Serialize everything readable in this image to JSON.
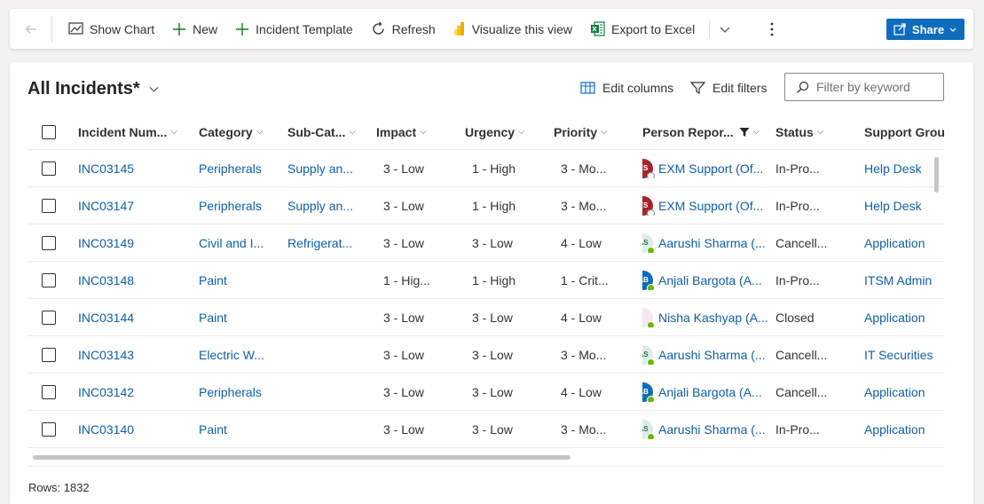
{
  "toolbar": {
    "show_chart": "Show Chart",
    "new": "New",
    "incident_template": "Incident Template",
    "refresh": "Refresh",
    "visualize": "Visualize this view",
    "export": "Export to Excel",
    "share": "Share"
  },
  "view": {
    "title": "All Incidents*",
    "edit_columns": "Edit columns",
    "edit_filters": "Edit filters",
    "filter_placeholder": "Filter by keyword"
  },
  "columns": {
    "incident_number": "Incident Num...",
    "category": "Category",
    "sub_category": "Sub-Cat...",
    "impact": "Impact",
    "urgency": "Urgency",
    "priority": "Priority",
    "person_reported": "Person Repor...",
    "status": "Status",
    "support_group": "Support Group"
  },
  "rows": [
    {
      "num": "INC03145",
      "category": "Peripherals",
      "sub": "Supply an...",
      "impact": "3 - Low",
      "urgency": "1 - High",
      "priority": "3 - Mo...",
      "initials": "ES",
      "person": "EXM Support (Of...",
      "status": "In-Pro...",
      "group": "Help Desk"
    },
    {
      "num": "INC03147",
      "category": "Peripherals",
      "sub": "Supply an...",
      "impact": "3 - Low",
      "urgency": "1 - High",
      "priority": "3 - Mo...",
      "initials": "ES",
      "person": "EXM Support (Of...",
      "status": "In-Pro...",
      "group": "Help Desk"
    },
    {
      "num": "INC03149",
      "category": "Civil and I...",
      "sub": "Refrigerat...",
      "impact": "3 - Low",
      "urgency": "3 - Low",
      "priority": "4 - Low",
      "initials": "AS",
      "person": "Aarushi Sharma (...",
      "status": "Cancell...",
      "group": "Application"
    },
    {
      "num": "INC03148",
      "category": "Paint",
      "sub": "",
      "impact": "1 - Hig...",
      "urgency": "1 - High",
      "priority": "1 - Crit...",
      "initials": "AB",
      "person": "Anjali Bargota (A...",
      "status": "In-Pro...",
      "group": "ITSM Admin"
    },
    {
      "num": "INC03144",
      "category": "Paint",
      "sub": "",
      "impact": "3 - Low",
      "urgency": "3 - Low",
      "priority": "4 - Low",
      "initials": "",
      "person": "Nisha Kashyap (A...",
      "status": "Closed",
      "group": "Application"
    },
    {
      "num": "INC03143",
      "category": "Electric W...",
      "sub": "",
      "impact": "3 - Low",
      "urgency": "3 - Low",
      "priority": "3 - Mo...",
      "initials": "AS",
      "person": "Aarushi Sharma (...",
      "status": "Cancell...",
      "group": "IT Securities"
    },
    {
      "num": "INC03142",
      "category": "Peripherals",
      "sub": "",
      "impact": "3 - Low",
      "urgency": "3 - Low",
      "priority": "4 - Low",
      "initials": "AB",
      "person": "Anjali Bargota (A...",
      "status": "Cancell...",
      "group": "Application"
    },
    {
      "num": "INC03140",
      "category": "Paint",
      "sub": "",
      "impact": "3 - Low",
      "urgency": "3 - Low",
      "priority": "3 - Mo...",
      "initials": "AS",
      "person": "Aarushi Sharma (...",
      "status": "In-Pro...",
      "group": "Application"
    }
  ],
  "footer": {
    "rows_count": "Rows: 1832"
  },
  "colors": {
    "accent": "#0f6cbd",
    "link": "#115ea3"
  }
}
